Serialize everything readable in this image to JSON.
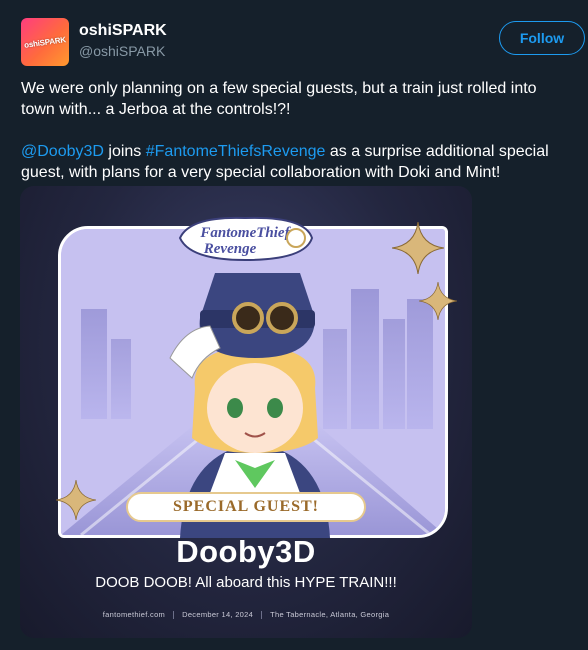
{
  "account": {
    "name": "oshiSPARK",
    "handle": "@oshiSPARK",
    "avatar_text": "oshiSPARK",
    "avatar_icon": "brand-logo-icon"
  },
  "follow_label": "Follow",
  "tweet": {
    "paragraph1": "We were only planning on a few special guests, but a train just rolled into town with... a Jerboa at the controls!?!",
    "mention": "@Dooby3D",
    "joins": " joins ",
    "hashtag": "#FantomeThiefsRevenge",
    "paragraph2_rest": " as a surprise additional special guest, with plans for a very special collaboration with Doki and Mint!"
  },
  "media": {
    "event_logo_line1": "FantomeThief",
    "event_logo_line2": "Revenge",
    "banner": "SPECIAL GUEST!",
    "guest_name": "Dooby3D",
    "tagline": "DOOB DOOB! All aboard this HYPE TRAIN!!!",
    "footer": {
      "site": "fantomethief.com",
      "date": "December 14, 2024",
      "venue": "The Tabernacle, Atlanta, Georgia"
    }
  },
  "colors": {
    "background": "#15202b",
    "accent": "#1d9bf0",
    "muted": "#8899a6",
    "banner_text": "#9a6a2a",
    "sparkle": "#d9b77a"
  }
}
